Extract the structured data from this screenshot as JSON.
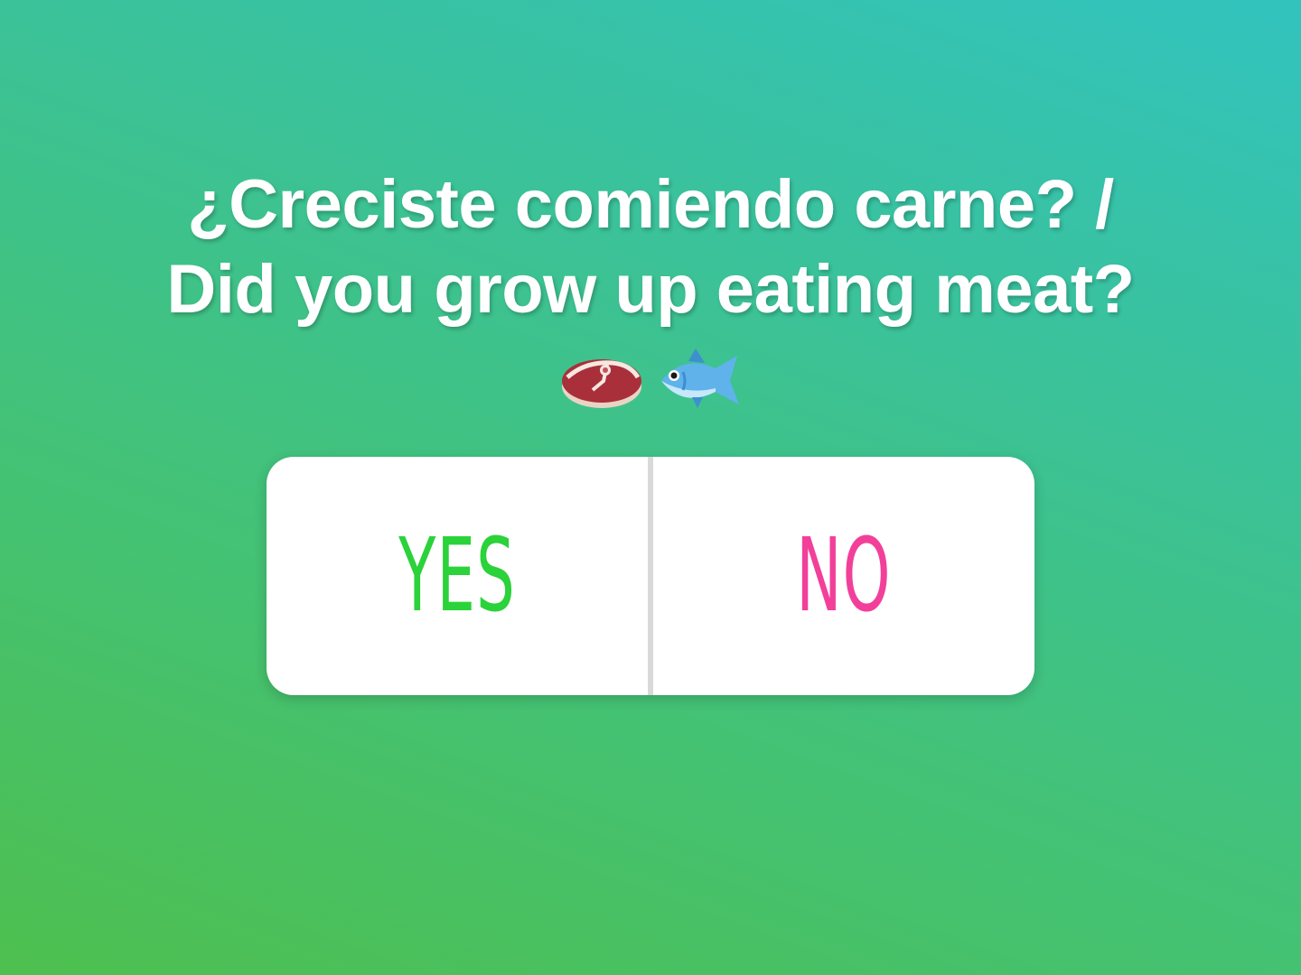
{
  "question": {
    "line1": "¿Creciste comiendo carne? /",
    "line2": "Did you grow up eating meat?"
  },
  "emojis": [
    {
      "icon": "meat-steak-icon"
    },
    {
      "icon": "fish-icon"
    }
  ],
  "poll": {
    "options": [
      {
        "label": "YES",
        "color": "#2bd23a"
      },
      {
        "label": "NO",
        "color": "#f2409a"
      }
    ]
  },
  "colors": {
    "background_start": "#4ec04f",
    "background_end": "#32c3be",
    "card": "#ffffff",
    "divider": "#d9d9d9"
  }
}
